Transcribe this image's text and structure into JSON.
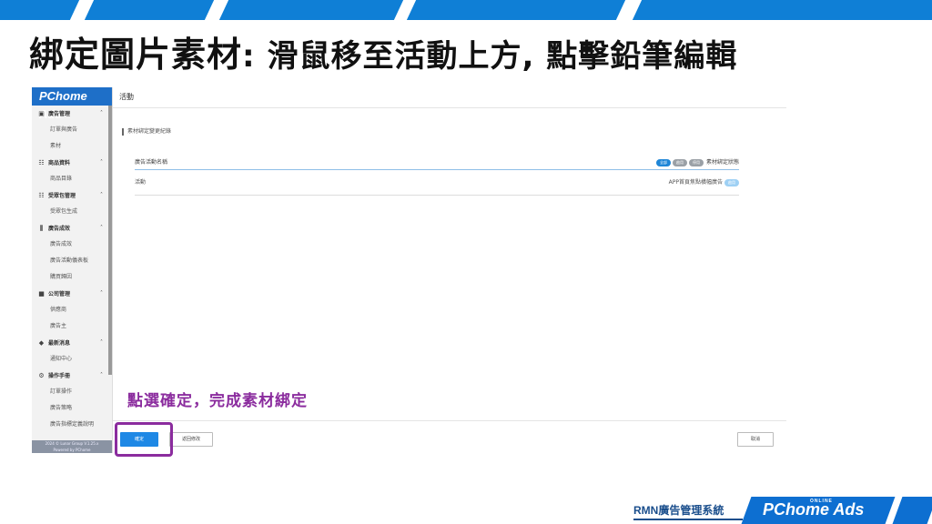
{
  "slide": {
    "title_main": "綁定圖片素材",
    "title_rest": ": 滑鼠移至活動上方, 點擊鉛筆編輯",
    "hint": "點選確定，完成素材綁定"
  },
  "colors": {
    "accent": "#0f7fd6",
    "hint": "#8b2c9e",
    "brand": "#1a4e8c"
  },
  "app": {
    "logo": "PChome Ads",
    "sidebar": {
      "groups": [
        {
          "icon": "tag-icon",
          "label": "廣告管理",
          "items": [
            "訂單與廣告",
            "素材"
          ]
        },
        {
          "icon": "grid-icon",
          "label": "商品資料",
          "items": [
            "商品目錄"
          ]
        },
        {
          "icon": "grid-icon",
          "label": "受眾包管理",
          "items": [
            "受眾包生成"
          ]
        },
        {
          "icon": "chart-icon",
          "label": "廣告成效",
          "items": [
            "廣告成效",
            "廣告活動儀表板",
            "購買歸因"
          ]
        },
        {
          "icon": "briefcase-icon",
          "label": "公司管理",
          "items": [
            "供應商",
            "廣告主"
          ]
        },
        {
          "icon": "bell-icon",
          "label": "最新消息",
          "items": [
            "通知中心"
          ]
        },
        {
          "icon": "gear-icon",
          "label": "操作手冊",
          "items": [
            "訂單操作",
            "廣告策略",
            "廣告指標定義說明"
          ]
        }
      ],
      "footer": "2024 © Lunar Group V.1.25.x\nPowered by PChome"
    },
    "header": {
      "title": "活動"
    },
    "section_title": "素材綁定變更紀錄",
    "table": {
      "col_name": "廣告活動名稱",
      "filters": [
        "全部",
        "啟用",
        "停用"
      ],
      "col_status": "素材綁定狀態",
      "rows": [
        {
          "name": "活動",
          "detail": "APP首頁焦點橫幅廣告",
          "status": "啟用"
        }
      ]
    },
    "buttons": {
      "confirm": "確定",
      "back": "返回修改",
      "cancel": "取消"
    }
  },
  "brand": {
    "text": "RMN廣告管理系統",
    "logo": "PChome Ads",
    "logo_sub": "ONLINE"
  }
}
